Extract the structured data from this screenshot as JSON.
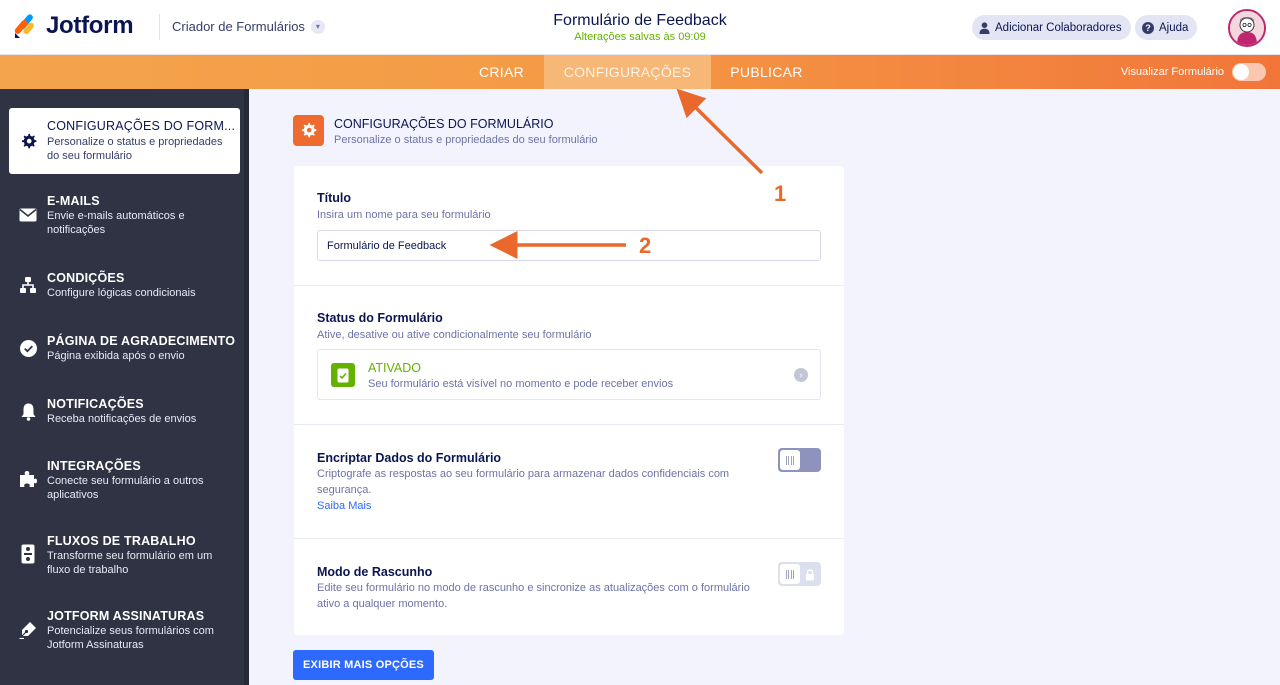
{
  "header": {
    "logo_text": "Jotform",
    "builder_dropdown": "Criador de Formulários",
    "form_title": "Formulário de Feedback",
    "saved_status": "Alterações salvas às 09:09",
    "add_collaborators": "Adicionar Colaboradores",
    "help": "Ajuda"
  },
  "nav": {
    "tabs": [
      {
        "label": "CRIAR"
      },
      {
        "label": "CONFIGURAÇÕES"
      },
      {
        "label": "PUBLICAR"
      }
    ],
    "preview_label": "Visualizar Formulário"
  },
  "sidebar": {
    "items": [
      {
        "title": "CONFIGURAÇÕES DO FORM...",
        "desc": "Personalize o status e propriedades do seu formulário",
        "icon": "gear-icon"
      },
      {
        "title": "E-MAILS",
        "desc": "Envie e-mails automáticos e notificações",
        "icon": "envelope-icon"
      },
      {
        "title": "CONDIÇÕES",
        "desc": "Configure lógicas condicionais",
        "icon": "hierarchy-icon"
      },
      {
        "title": "PÁGINA DE AGRADECIMENTO",
        "desc": "Página exibida após o envio",
        "icon": "check-circle-icon"
      },
      {
        "title": "NOTIFICAÇÕES",
        "desc": "Receba notificações de envios",
        "icon": "bell-icon"
      },
      {
        "title": "INTEGRAÇÕES",
        "desc": "Conecte seu formulário a outros aplicativos",
        "icon": "puzzle-icon"
      },
      {
        "title": "FLUXOS DE TRABALHO",
        "desc": "Transforme seu formulário em um fluxo de trabalho",
        "icon": "workflow-icon"
      },
      {
        "title": "JOTFORM ASSINATURAS",
        "desc": "Potencialize seus formulários com Jotform Assinaturas",
        "icon": "signature-pen-icon"
      }
    ]
  },
  "main": {
    "section_title": "CONFIGURAÇÕES DO FORMULÁRIO",
    "section_subtitle": "Personalize o status e propriedades do seu formulário",
    "title_field": {
      "label": "Título",
      "hint": "Insira um nome para seu formulário",
      "value": "Formulário de Feedback"
    },
    "status": {
      "label": "Status do Formulário",
      "hint": "Ative, desative ou ative condicionalmente seu formulário",
      "state": "ATIVADO",
      "state_desc": "Seu formulário está visível no momento e pode receber envios"
    },
    "encrypt": {
      "label": "Encriptar Dados do Formulário",
      "hint": "Criptografe as respostas ao seu formulário para armazenar dados confidenciais com segurança.",
      "link": "Saiba Mais",
      "enabled": false
    },
    "draft": {
      "label": "Modo de Rascunho",
      "hint": "Edite seu formulário no modo de rascunho e sincronize as atualizações com o formulário ativo a qualquer momento.",
      "enabled": false,
      "locked": true
    },
    "more_options_button": "EXIBIR MAIS OPÇÕES"
  },
  "annotations": {
    "marker_1": "1",
    "marker_2": "2"
  },
  "colors": {
    "accent_orange": "#ee6a2f",
    "nav_gradient_start": "#f4a44d",
    "nav_gradient_end": "#f2763a",
    "sidebar_bg": "#2f3343",
    "primary_blue": "#2e69ff",
    "success_green": "#64b200",
    "annotation_orange": "#e8692b"
  }
}
